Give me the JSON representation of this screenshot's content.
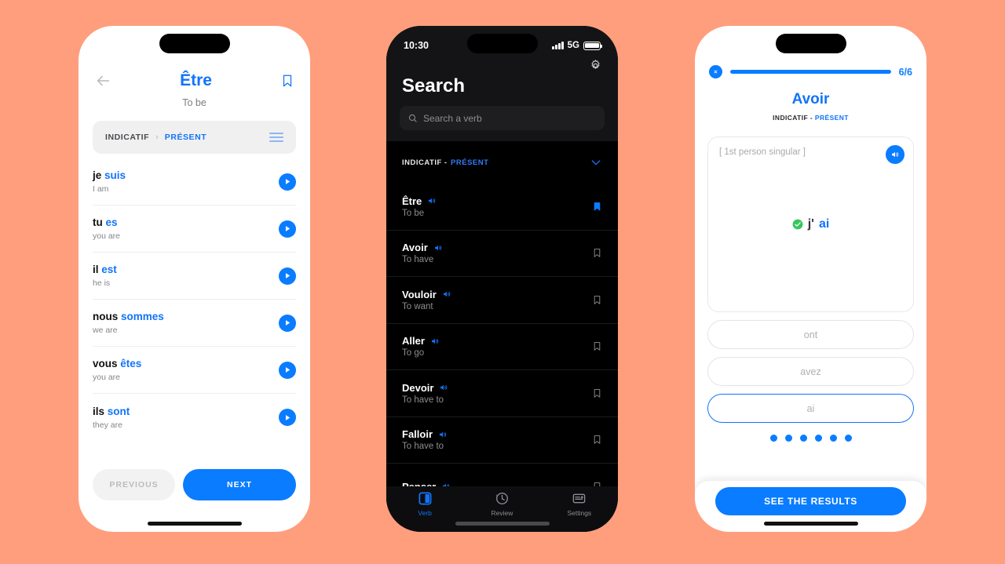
{
  "theme": {
    "background": "#ff9e7d",
    "accent_blue": "#0a7cff",
    "link_blue": "#1273fa",
    "success_green": "#34c759",
    "dark_bg": "#000000",
    "dark_header_bg": "#141416"
  },
  "phone_conjugation": {
    "back_icon": "arrow-left-icon",
    "bookmark_icon": "bookmark-outline-icon",
    "title": "Être",
    "subtitle": "To be",
    "segment": {
      "mood": "INDICATIF",
      "separator": "›",
      "tense": "PRÉSENT",
      "menu_icon": "list-menu-icon"
    },
    "rows": [
      {
        "pronoun": "je",
        "verb": "suis",
        "translation": "I am",
        "play_icon": "play-circle-icon"
      },
      {
        "pronoun": "tu",
        "verb": "es",
        "translation": "you are",
        "play_icon": "play-circle-icon"
      },
      {
        "pronoun": "il",
        "verb": "est",
        "translation": "he is",
        "play_icon": "play-circle-icon"
      },
      {
        "pronoun": "nous",
        "verb": "sommes",
        "translation": "we are",
        "play_icon": "play-circle-icon"
      },
      {
        "pronoun": "vous",
        "verb": "êtes",
        "translation": "you are",
        "play_icon": "play-circle-icon"
      },
      {
        "pronoun": "ils",
        "verb": "sont",
        "translation": "they are",
        "play_icon": "play-circle-icon"
      }
    ],
    "previous_label": "PREVIOUS",
    "next_label": "NEXT"
  },
  "phone_search": {
    "status_bar": {
      "time": "10:30",
      "signal_icon": "cellular-bars-icon",
      "network": "5G",
      "battery_icon": "battery-full-icon"
    },
    "settings_icon": "gear-icon",
    "heading": "Search",
    "search_placeholder": "Search a verb",
    "search_icon": "search-icon",
    "filter": {
      "mood": "INDICATIF -",
      "tense": "PRÉSENT",
      "chevron_icon": "chevron-down-icon"
    },
    "verbs": [
      {
        "verb": "Être",
        "translation": "To be",
        "speaker_icon": "speaker-icon",
        "bookmark_icon": "bookmark-filled-icon",
        "bookmarked": true
      },
      {
        "verb": "Avoir",
        "translation": "To have",
        "speaker_icon": "speaker-icon",
        "bookmark_icon": "bookmark-outline-icon",
        "bookmarked": false
      },
      {
        "verb": "Vouloir",
        "translation": "To want",
        "speaker_icon": "speaker-icon",
        "bookmark_icon": "bookmark-outline-icon",
        "bookmarked": false
      },
      {
        "verb": "Aller",
        "translation": "To go",
        "speaker_icon": "speaker-icon",
        "bookmark_icon": "bookmark-outline-icon",
        "bookmarked": false
      },
      {
        "verb": "Devoir",
        "translation": "To have to",
        "speaker_icon": "speaker-icon",
        "bookmark_icon": "bookmark-outline-icon",
        "bookmarked": false
      },
      {
        "verb": "Falloir",
        "translation": "To have to",
        "speaker_icon": "speaker-icon",
        "bookmark_icon": "bookmark-outline-icon",
        "bookmarked": false
      },
      {
        "verb": "Penser",
        "translation": "",
        "speaker_icon": "speaker-icon",
        "bookmark_icon": "bookmark-outline-icon",
        "bookmarked": false
      }
    ],
    "tabs": [
      {
        "label": "Verb",
        "icon": "book-icon",
        "active": true
      },
      {
        "label": "Review",
        "icon": "history-icon",
        "active": false
      },
      {
        "label": "Settings",
        "icon": "sliders-icon",
        "active": false
      }
    ]
  },
  "phone_quiz": {
    "close_icon": "close-circle-icon",
    "progress_percent": 100,
    "progress_label": "6/6",
    "title": "Avoir",
    "sub_mood": "INDICATIF - ",
    "sub_tense": "PRÉSENT",
    "card": {
      "hint": "[ 1st person singular ]",
      "speaker_icon": "speaker-circle-icon",
      "check_icon": "check-circle-icon",
      "answer_prefix": "j'",
      "answer_highlight": "ai"
    },
    "options": [
      {
        "label": "ont",
        "selected": false
      },
      {
        "label": "avez",
        "selected": false
      },
      {
        "label": "ai",
        "selected": true
      }
    ],
    "dots_total": 6,
    "cta_label": "SEE THE RESULTS"
  }
}
